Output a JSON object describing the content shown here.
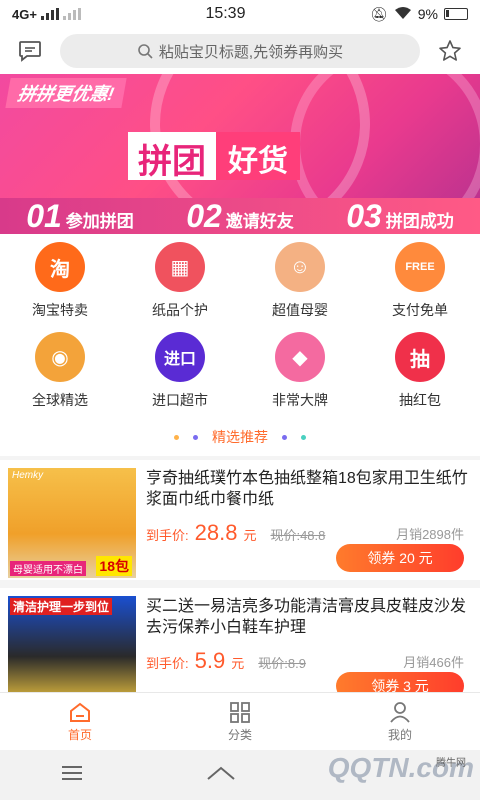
{
  "status_bar": {
    "network": "4G+",
    "time": "15:39",
    "battery": "9%"
  },
  "search": {
    "placeholder": "粘贴宝贝标题,先领券再购买"
  },
  "banner": {
    "tag": "拼拼更优惠!",
    "title_part1": "拼团",
    "title_part2": "好货",
    "steps": [
      {
        "num": "01",
        "text": "参加拼团"
      },
      {
        "num": "02",
        "text": "邀请好友"
      },
      {
        "num": "03",
        "text": "拼团成功"
      }
    ]
  },
  "categories": [
    {
      "label": "淘宝特卖",
      "icon": "taobao-icon",
      "glyph": "淘",
      "color": "#ff6a1a"
    },
    {
      "label": "纸品个护",
      "icon": "tissue-icon",
      "glyph": "▦",
      "color": "#f0525e"
    },
    {
      "label": "超值母婴",
      "icon": "mother-baby-icon",
      "glyph": "☺",
      "color": "#f4b183"
    },
    {
      "label": "支付免单",
      "icon": "free-icon",
      "glyph": "FREE",
      "color": "#ff8a3c"
    },
    {
      "label": "全球精选",
      "icon": "globe-icon",
      "glyph": "◉",
      "color": "#f3a33a"
    },
    {
      "label": "进口超市",
      "icon": "import-market-icon",
      "glyph": "进口",
      "color": "#5a2bd4"
    },
    {
      "label": "非常大牌",
      "icon": "diamond-icon",
      "glyph": "◆",
      "color": "#f46aa0"
    },
    {
      "label": "抽红包",
      "icon": "red-packet-icon",
      "glyph": "抽",
      "color": "#f0304a"
    }
  ],
  "section": {
    "title": "精选推荐"
  },
  "products": [
    {
      "title": "亨奇抽纸璞竹本色抽纸整箱18包家用卫生纸竹浆面巾纸巾餐巾纸",
      "price_label": "到手价:",
      "price": "28.8",
      "price_unit": "元",
      "original_price": "现价:48.8",
      "sales": "月销2898件",
      "coupon": "领券 20 元",
      "image_caption_top": "Hemky",
      "image_caption_bottom": "母婴适用不漂白",
      "image_badge": "18包"
    },
    {
      "title": "买二送一易洁亮多功能清洁膏皮具皮鞋皮沙发去污保养小白鞋车护理",
      "price_label": "到手价:",
      "price": "5.9",
      "price_unit": "元",
      "original_price": "现价:8.9",
      "sales": "月销466件",
      "coupon": "领券 3 元",
      "image_caption_top": "清洁护理一步到位"
    }
  ],
  "bottom_nav": [
    {
      "label": "首页",
      "icon": "home-icon",
      "active": true
    },
    {
      "label": "分类",
      "icon": "category-icon",
      "active": false
    },
    {
      "label": "我的",
      "icon": "profile-icon",
      "active": false
    }
  ],
  "watermark": {
    "brand": "QQTN.com",
    "small": "腾牛网"
  },
  "colors": {
    "accent": "#ff6b2c",
    "banner": "#f24aa0"
  }
}
